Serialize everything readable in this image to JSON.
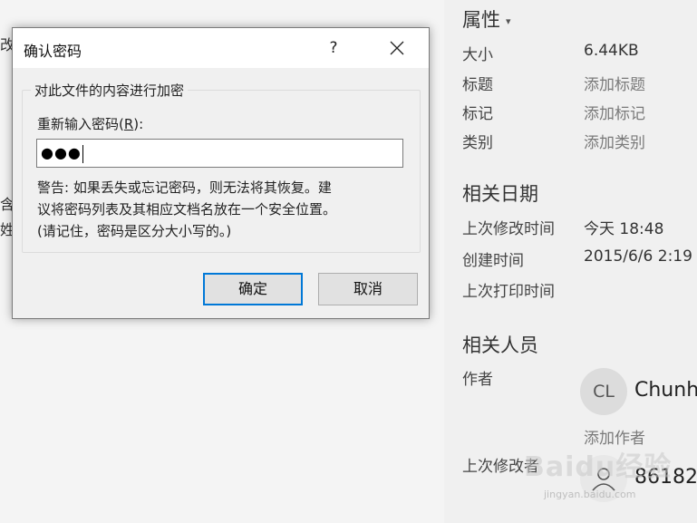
{
  "background": {
    "edge_glyphs": [
      "改",
      "含",
      "姓"
    ]
  },
  "dialog": {
    "title": "确认密码",
    "help_label": "?",
    "group_title": "对此文件的内容进行加密",
    "field_label_prefix": "重新输入密码(",
    "field_label_accel": "R",
    "field_label_suffix": "):",
    "password_value": "●●●",
    "warning_lines": [
      "警告: 如果丢失或忘记密码，则无法将其恢复。建",
      "议将密码列表及其相应文档名放在一个安全位置。",
      "(请记住，密码是区分大小写的。)"
    ],
    "ok_label": "确定",
    "cancel_label": "取消"
  },
  "properties": {
    "heading": "属性",
    "rows": [
      {
        "label": "大小",
        "value": "6.44KB"
      },
      {
        "label": "标题",
        "value": "添加标题"
      },
      {
        "label": "标记",
        "value": "添加标记"
      },
      {
        "label": "类别",
        "value": "添加类别"
      }
    ]
  },
  "dates": {
    "heading": "相关日期",
    "rows": [
      {
        "label": "上次修改时间",
        "value": "今天 18:48"
      },
      {
        "label": "创建时间",
        "value": "2015/6/6 2:19"
      },
      {
        "label": "上次打印时间",
        "value": ""
      }
    ]
  },
  "people": {
    "heading": "相关人员",
    "author_label": "作者",
    "author_initials": "CL",
    "author_name": "Chunh",
    "add_author": "添加作者",
    "modifier_label": "上次修改者",
    "modifier_name": "86182"
  },
  "watermark": {
    "text": "Baidu经验",
    "sub": "jingyan.baidu.com"
  }
}
